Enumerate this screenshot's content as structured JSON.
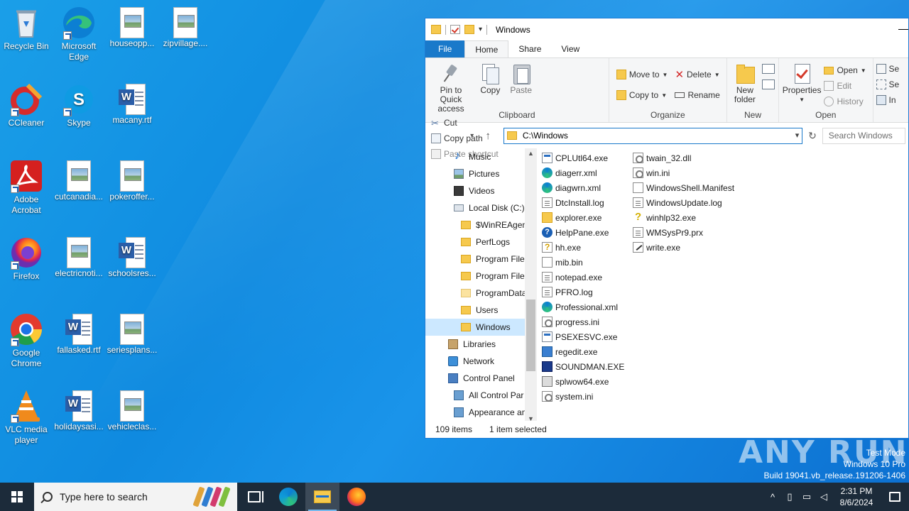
{
  "desktop": {
    "icons": [
      {
        "label": "Recycle Bin",
        "icon": "recycle-bin-icon"
      },
      {
        "label": "Microsoft Edge",
        "icon": "edge-icon"
      },
      {
        "label": "houseopp...",
        "icon": "image-file-icon"
      },
      {
        "label": "zipvillage....",
        "icon": "image-file-icon"
      },
      {
        "label": "CCleaner",
        "icon": "ccleaner-icon"
      },
      {
        "label": "Skype",
        "icon": "skype-icon"
      },
      {
        "label": "macany.rtf",
        "icon": "word-doc-icon"
      },
      {
        "label": "Adobe Acrobat",
        "icon": "acrobat-icon"
      },
      {
        "label": "cutcanadia...",
        "icon": "image-file-icon"
      },
      {
        "label": "pokeroffer...",
        "icon": "image-file-icon"
      },
      {
        "label": "Firefox",
        "icon": "firefox-icon"
      },
      {
        "label": "electricnoti...",
        "icon": "image-file-icon"
      },
      {
        "label": "schoolsres...",
        "icon": "word-doc-icon"
      },
      {
        "label": "Google Chrome",
        "icon": "chrome-icon"
      },
      {
        "label": "fallasked.rtf",
        "icon": "word-doc-icon"
      },
      {
        "label": "seriesplans...",
        "icon": "image-file-icon"
      },
      {
        "label": "VLC media player",
        "icon": "vlc-icon"
      },
      {
        "label": "holidaysasi...",
        "icon": "word-doc-icon"
      },
      {
        "label": "vehicleclas...",
        "icon": "image-file-icon"
      }
    ]
  },
  "explorer": {
    "title": "Windows",
    "tabs": {
      "file": "File",
      "home": "Home",
      "share": "Share",
      "view": "View"
    },
    "ribbon": {
      "clipboard": {
        "label": "Clipboard",
        "pin": "Pin to Quick access",
        "copy": "Copy",
        "paste": "Paste",
        "cut": "Cut",
        "copy_path": "Copy path",
        "paste_shortcut": "Paste shortcut"
      },
      "organize": {
        "label": "Organize",
        "move_to": "Move to",
        "copy_to": "Copy to",
        "delete": "Delete",
        "rename": "Rename"
      },
      "new": {
        "label": "New",
        "new_folder": "New folder"
      },
      "open": {
        "label": "Open",
        "properties": "Properties",
        "open": "Open",
        "edit": "Edit",
        "history": "History"
      },
      "select": {
        "item1": "Se",
        "item2": "Se",
        "item3": "In"
      }
    },
    "address": "C:\\Windows",
    "search_placeholder": "Search Windows",
    "nav_items": [
      {
        "label": "Music",
        "icon": "music-icon",
        "indent": 2
      },
      {
        "label": "Pictures",
        "icon": "pictures-icon",
        "indent": 2
      },
      {
        "label": "Videos",
        "icon": "videos-icon",
        "indent": 2
      },
      {
        "label": "Local Disk (C:)",
        "icon": "drive-icon",
        "indent": 2
      },
      {
        "label": "$WinREAgent",
        "icon": "folder-icon",
        "indent": 3
      },
      {
        "label": "PerfLogs",
        "icon": "folder-icon",
        "indent": 3
      },
      {
        "label": "Program Files",
        "icon": "folder-icon",
        "indent": 3
      },
      {
        "label": "Program Files",
        "icon": "folder-icon",
        "indent": 3
      },
      {
        "label": "ProgramData",
        "icon": "folder-light-icon",
        "indent": 3
      },
      {
        "label": "Users",
        "icon": "folder-icon",
        "indent": 3
      },
      {
        "label": "Windows",
        "icon": "folder-icon",
        "indent": 3,
        "selected": true
      },
      {
        "label": "Libraries",
        "icon": "libraries-icon",
        "indent": 1
      },
      {
        "label": "Network",
        "icon": "network-icon",
        "indent": 1
      },
      {
        "label": "Control Panel",
        "icon": "control-panel-icon",
        "indent": 1
      },
      {
        "label": "All Control Par",
        "icon": "control-panel-icon",
        "indent": 2
      },
      {
        "label": "Appearance an",
        "icon": "control-panel-icon",
        "indent": 2
      }
    ],
    "files_col1": [
      {
        "name": "CPLUtl64.exe",
        "icon": "exe"
      },
      {
        "name": "diagerr.xml",
        "icon": "edge"
      },
      {
        "name": "diagwrn.xml",
        "icon": "edge"
      },
      {
        "name": "DtcInstall.log",
        "icon": "doc"
      },
      {
        "name": "explorer.exe",
        "icon": "folderexe"
      },
      {
        "name": "HelpPane.exe",
        "icon": "help"
      },
      {
        "name": "hh.exe",
        "icon": "hh"
      },
      {
        "name": "mib.bin",
        "icon": "blank"
      },
      {
        "name": "notepad.exe",
        "icon": "doc"
      },
      {
        "name": "PFRO.log",
        "icon": "doc"
      },
      {
        "name": "Professional.xml",
        "icon": "edge"
      },
      {
        "name": "progress.ini",
        "icon": "gear"
      },
      {
        "name": "PSEXESVC.exe",
        "icon": "exe"
      },
      {
        "name": "regedit.exe",
        "icon": "reg"
      },
      {
        "name": "SOUNDMAN.EXE",
        "icon": "sound"
      },
      {
        "name": "splwow64.exe",
        "icon": "printer"
      },
      {
        "name": "system.ini",
        "icon": "gear"
      }
    ],
    "files_col2": [
      {
        "name": "twain_32.dll",
        "icon": "gear"
      },
      {
        "name": "win.ini",
        "icon": "gear"
      },
      {
        "name": "WindowsShell.Manifest",
        "icon": "blank"
      },
      {
        "name": "WindowsUpdate.log",
        "icon": "doc"
      },
      {
        "name": "winhlp32.exe",
        "icon": "qmark"
      },
      {
        "name": "WMSysPr9.prx",
        "icon": "doc"
      },
      {
        "name": "write.exe",
        "icon": "write"
      }
    ],
    "status": {
      "count": "109 items",
      "selection": "1 item selected"
    }
  },
  "watermark": "ANY RUN",
  "os_info": {
    "line1": "Test Mode",
    "line2": "Windows 10 Pro",
    "line3": "Build 19041.vb_release.191206-1406"
  },
  "taskbar": {
    "search_placeholder": "Type here to search",
    "clock_time": "2:31 PM",
    "clock_date": "8/6/2024"
  },
  "colors": {
    "accent": "#1979ca",
    "taskbar": "#1c2b3a",
    "selection": "#cce8ff"
  }
}
